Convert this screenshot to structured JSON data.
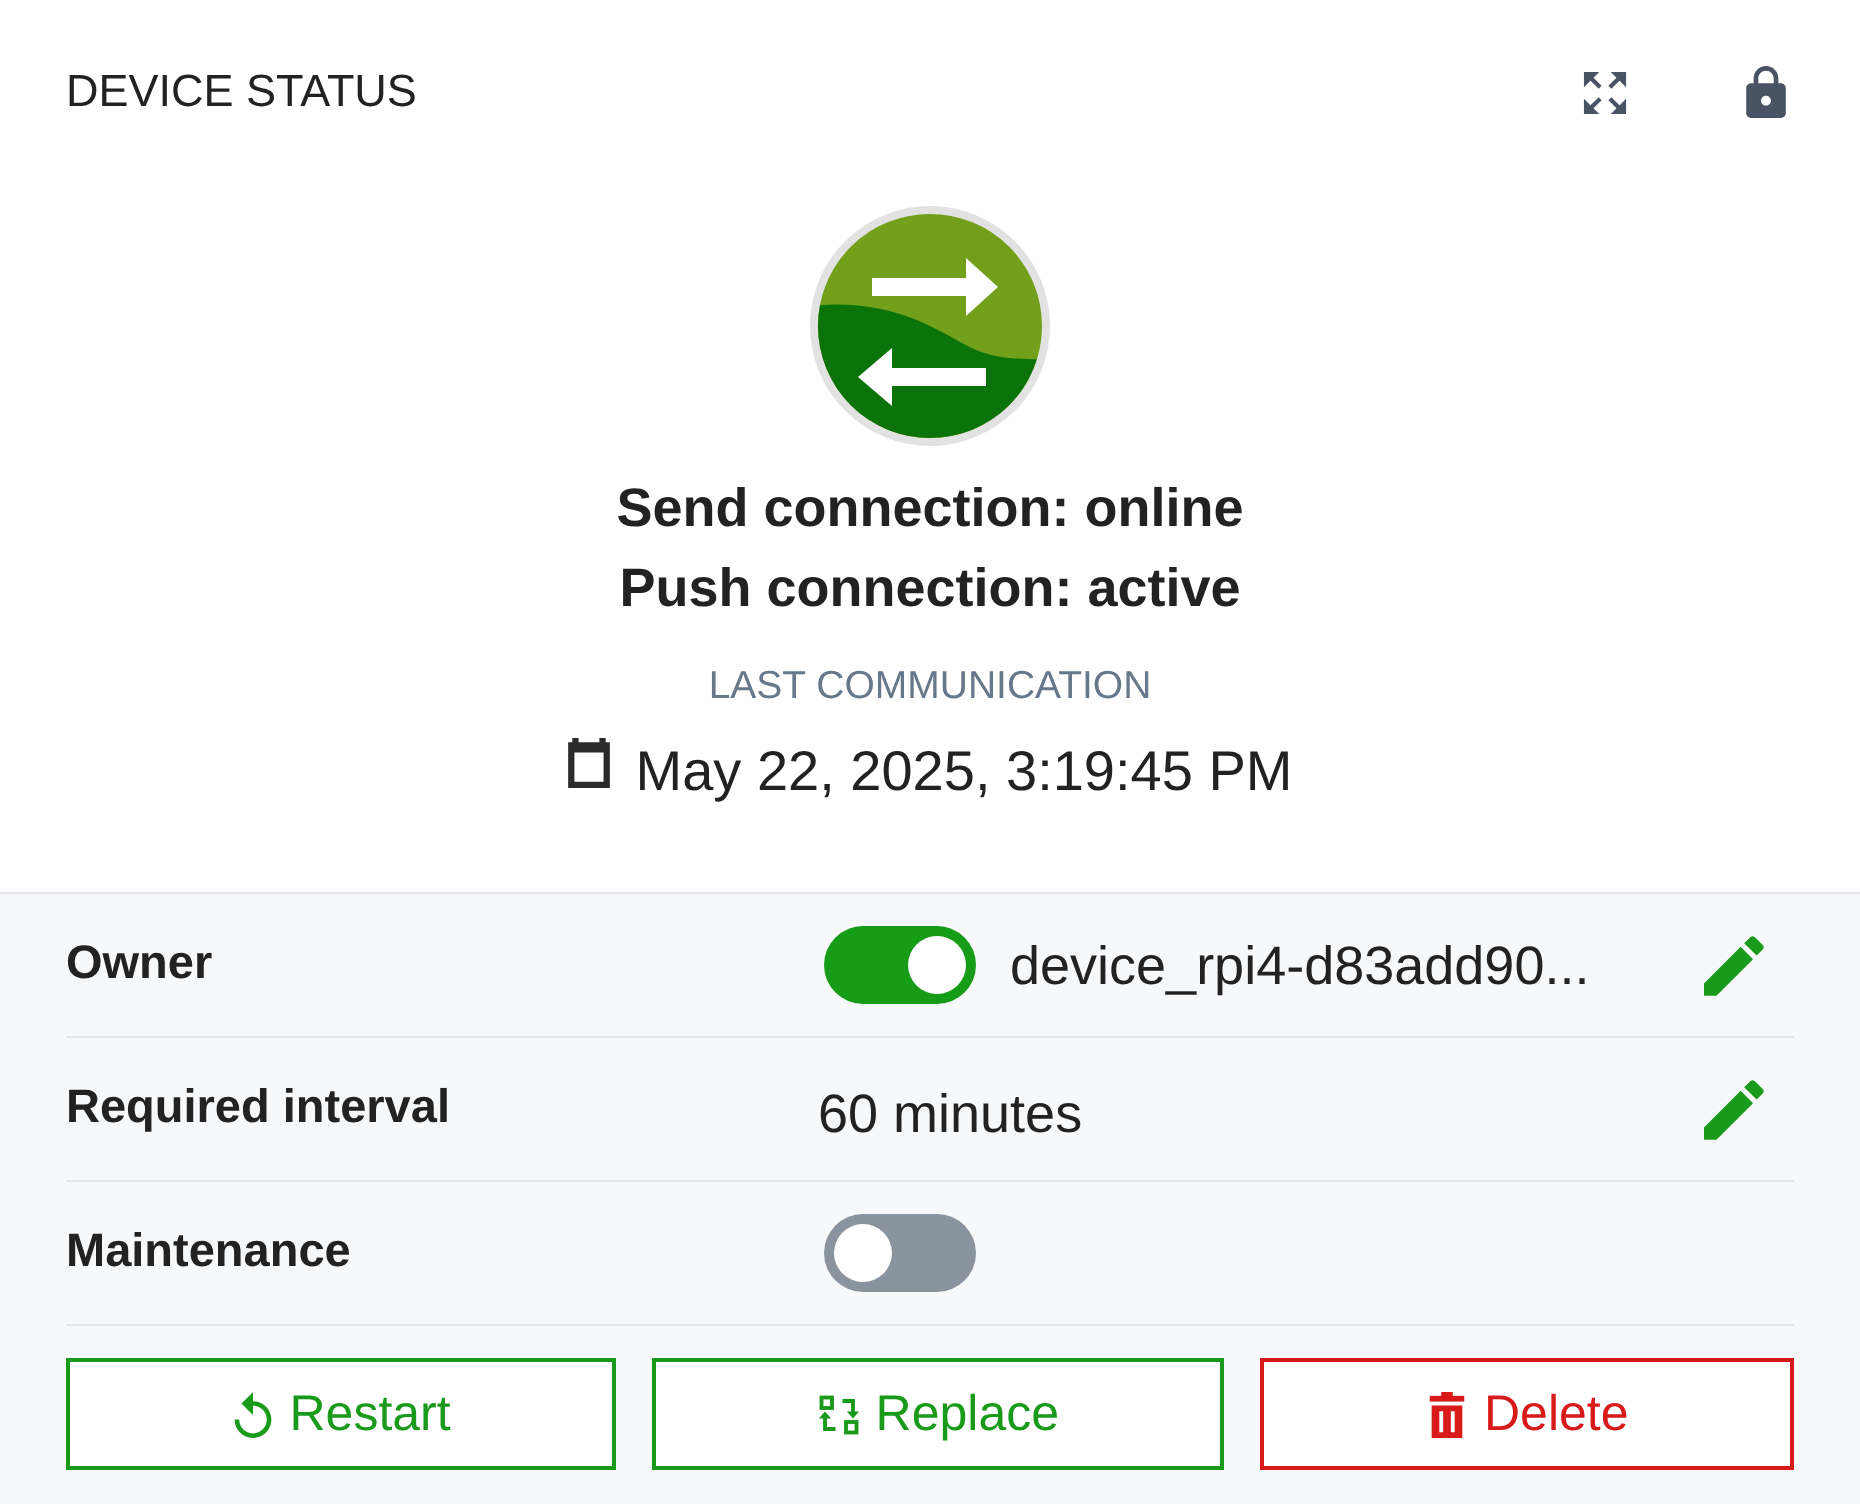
{
  "header": {
    "title": "DEVICE STATUS"
  },
  "status": {
    "lines": [
      "Send connection: online",
      "Push connection: active"
    ],
    "last_label": "LAST COMMUNICATION",
    "last_value": "May 22, 2025, 3:19:45 PM"
  },
  "properties": [
    {
      "label": "Owner",
      "kind": "toggle_value",
      "on": true,
      "value": "device_rpi4-d83add90...",
      "editable": true
    },
    {
      "label": "Required interval",
      "kind": "value",
      "value": "60 minutes",
      "editable": true
    },
    {
      "label": "Maintenance",
      "kind": "toggle",
      "on": false,
      "editable": false
    }
  ],
  "actions": [
    {
      "label": "Restart",
      "kind": "restart"
    },
    {
      "label": "Replace",
      "kind": "replace"
    },
    {
      "label": "Delete",
      "kind": "delete"
    }
  ]
}
